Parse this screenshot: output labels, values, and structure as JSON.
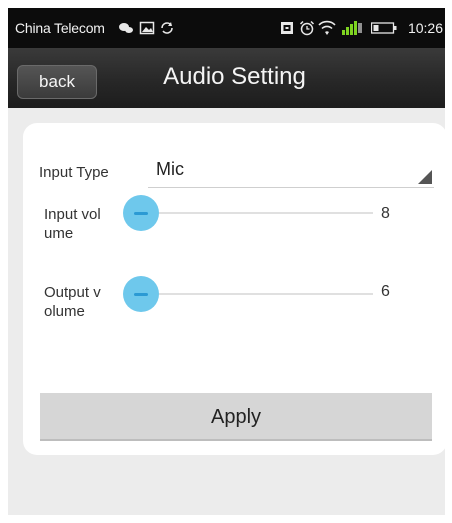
{
  "status_bar": {
    "carrier": "China Telecom",
    "time": "10:26",
    "icons": [
      "chat-bubble-icon",
      "image-icon",
      "sync-icon",
      "sim-icon",
      "alarm-icon",
      "wifi-icon",
      "signal-icon",
      "battery-icon"
    ]
  },
  "header": {
    "back_label": "back",
    "title": "Audio Setting"
  },
  "form": {
    "input_type_label": "Input Type",
    "input_type_value": "Mic",
    "input_volume_label": "Input volume",
    "input_volume_value": "8",
    "input_volume_level": 0,
    "output_volume_label": "Output volume",
    "output_volume_value": "6",
    "output_volume_level": 0,
    "apply_label": "Apply"
  },
  "colors": {
    "status_bar_bg": "#0c0c0c",
    "title_bar_bg": "#2a2a2a",
    "slider_thumb": "#6ec8ec",
    "slider_thumb_inner": "#2b9ad4",
    "signal_green": "#7ed321",
    "page_bg": "#ececec",
    "button_bg": "#d6d6d6"
  }
}
